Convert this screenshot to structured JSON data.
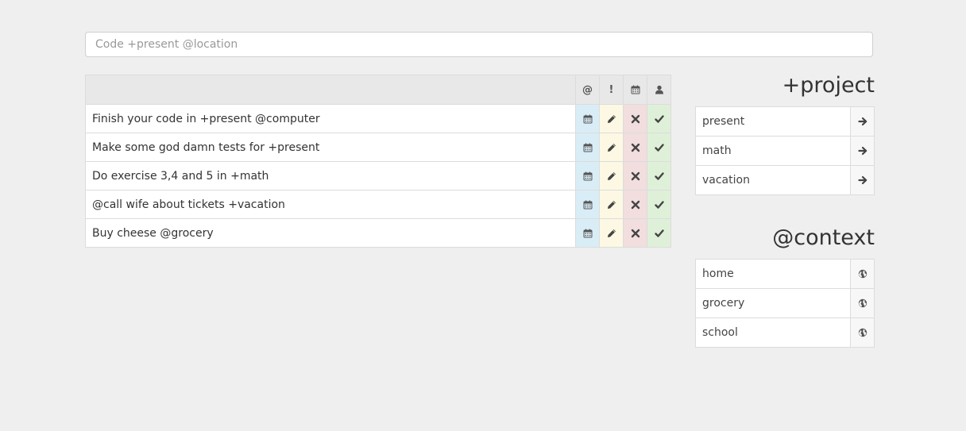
{
  "search": {
    "placeholder": "Code +present @location"
  },
  "task_table": {
    "headers": [
      {
        "glyph": "@",
        "icon": "at-icon"
      },
      {
        "glyph": "!",
        "icon": "exclamation-icon"
      },
      {
        "icon": "calendar-icon"
      },
      {
        "icon": "user-icon"
      }
    ],
    "row_actions": [
      "calendar-icon",
      "pencil-icon",
      "close-icon",
      "check-icon"
    ],
    "tasks": [
      {
        "text": "Finish your code in +present @computer"
      },
      {
        "text": "Make some god damn tests for +present"
      },
      {
        "text": "Do exercise 3,4 and 5 in +math"
      },
      {
        "text": "@call wife about tickets +vacation"
      },
      {
        "text": "Buy cheese @grocery"
      }
    ],
    "column_colors": [
      "#d9edf7",
      "#fcf8e3",
      "#f2dede",
      "#dff0d8"
    ]
  },
  "projects": {
    "title": "+project",
    "action_icon": "arrow-right-icon",
    "items": [
      {
        "label": "present"
      },
      {
        "label": "math"
      },
      {
        "label": "vacation"
      }
    ]
  },
  "contexts": {
    "title": "@context",
    "action_icon": "globe-icon",
    "items": [
      {
        "label": "home"
      },
      {
        "label": "grocery"
      },
      {
        "label": "school"
      }
    ]
  }
}
